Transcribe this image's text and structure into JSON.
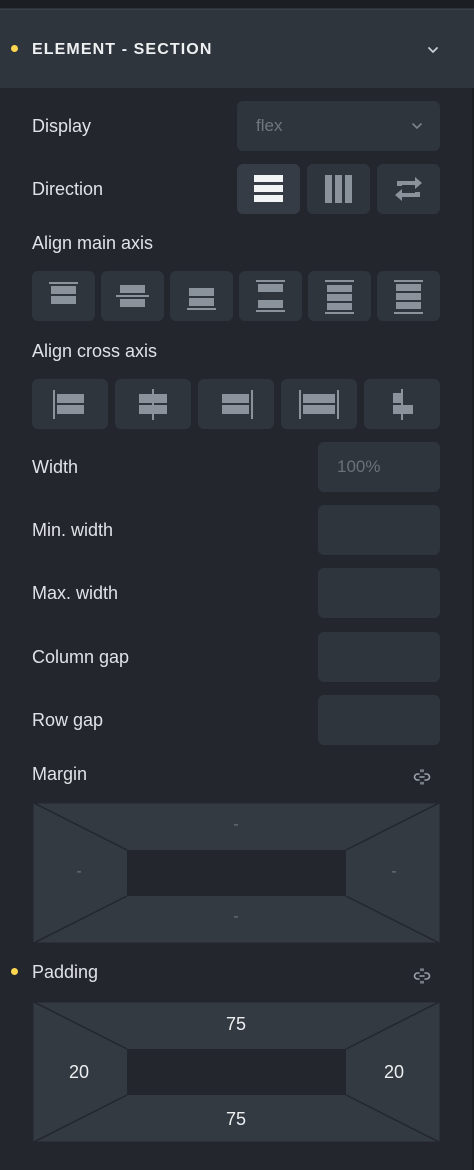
{
  "header": {
    "title": "ELEMENT - SECTION"
  },
  "display": {
    "label": "Display",
    "value": "flex"
  },
  "direction": {
    "label": "Direction"
  },
  "align_main": {
    "label": "Align main axis"
  },
  "align_cross": {
    "label": "Align cross axis"
  },
  "width": {
    "label": "Width",
    "placeholder": "100%"
  },
  "min_width": {
    "label": "Min. width",
    "value": ""
  },
  "max_width": {
    "label": "Max. width",
    "value": ""
  },
  "column_gap": {
    "label": "Column gap",
    "value": ""
  },
  "row_gap": {
    "label": "Row gap",
    "value": ""
  },
  "margin": {
    "label": "Margin",
    "top": "-",
    "right": "-",
    "bottom": "-",
    "left": "-"
  },
  "padding": {
    "label": "Padding",
    "top": "75",
    "right": "20",
    "bottom": "75",
    "left": "20"
  },
  "icons": {
    "header_chevron": "chevron-down-icon",
    "select_chevron": "chevron-down-icon",
    "link": "unlink-icon"
  },
  "colors": {
    "background": "#23272d",
    "panel": "#2f353d",
    "indicator": "#ffd64f",
    "text": "#dfe2e6",
    "muted": "#6e7680"
  }
}
